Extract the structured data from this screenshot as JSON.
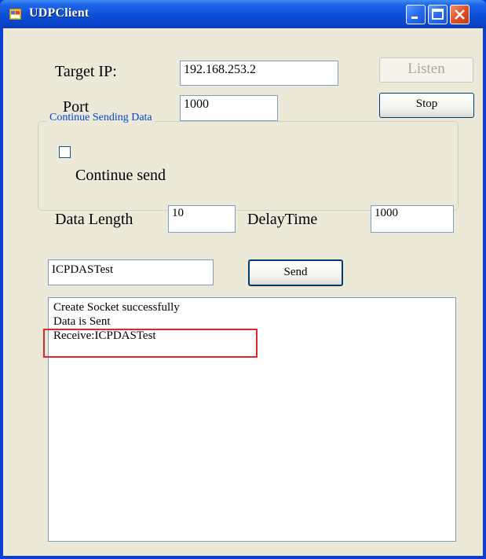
{
  "window": {
    "title": "UDPClient"
  },
  "titlebar_buttons": [
    "minimize-icon",
    "maximize-icon",
    "close-icon"
  ],
  "target": {
    "ip_label": "Target IP:",
    "ip_value": "192.168.253.2",
    "port_label": "Port",
    "port_value": "1000"
  },
  "buttons": {
    "listen": "Listen",
    "stop": "Stop",
    "send": "Send"
  },
  "continue_group": {
    "title": "Continue Sending Data",
    "checkbox_label": "Continue send",
    "checkbox_checked": false,
    "data_length_label": "Data Length",
    "data_length_value": "10",
    "delay_label": "DelayTime",
    "delay_value": "1000"
  },
  "message": {
    "value": "ICPDASTest"
  },
  "log": {
    "lines": [
      "Create Socket successfully",
      "Data is Sent",
      "Receive:ICPDASTest"
    ]
  },
  "colors": {
    "highlight": "#e0272a",
    "titlebar": "#0a4ed8",
    "group_title": "#0046d5"
  }
}
